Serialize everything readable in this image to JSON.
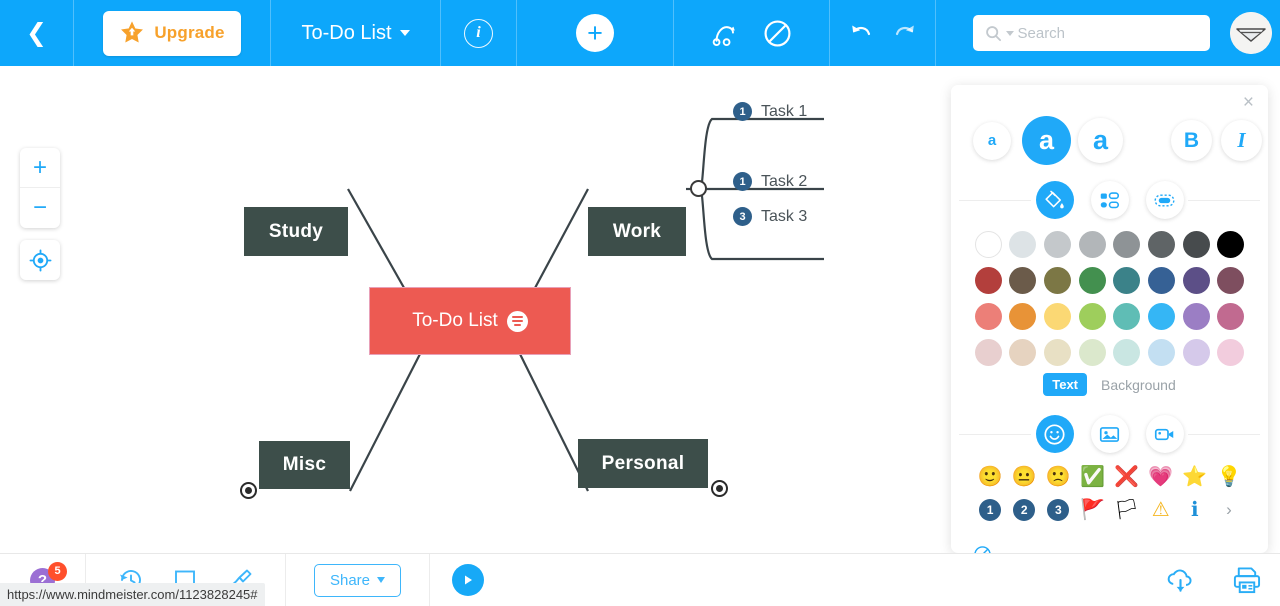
{
  "toolbar": {
    "back_icon": "chevron-left-icon",
    "upgrade_label": "Upgrade",
    "upgrade_icon": "star-icon",
    "map_title": "To-Do List",
    "title_caret_icon": "chevron-down-icon",
    "info_icon": "info-icon",
    "info_glyph": "i",
    "add_icon": "plus-icon",
    "add_glyph": "+",
    "connection_icon": "connection-icon",
    "noentry_icon": "no-entry-icon",
    "undo_icon": "undo-icon",
    "redo_icon": "redo-icon",
    "search_placeholder": "Search",
    "search_value": "",
    "search_icon": "search-icon",
    "avatar_icon": "user-avatar",
    "bg_color": "#0DA7FB"
  },
  "zoom_controls": {
    "zoom_in_label": "+",
    "zoom_out_label": "−",
    "center_icon": "crosshair-icon"
  },
  "map": {
    "root": {
      "label": "To-Do List",
      "color": "#ED5A52",
      "note_icon": "note-icon"
    },
    "branches": [
      {
        "label": "Study",
        "color": "#3D4E4A"
      },
      {
        "label": "Work",
        "color": "#3D4E4A"
      },
      {
        "label": "Misc",
        "color": "#3D4E4A"
      },
      {
        "label": "Personal",
        "color": "#3D4E4A"
      }
    ],
    "tasks": [
      {
        "badge": "1",
        "label": "Task 1"
      },
      {
        "badge": "1",
        "label": "Task 2"
      },
      {
        "badge": "3",
        "label": "Task 3"
      }
    ],
    "badge_color": "#2E5F8A",
    "line_color": "#3A4449"
  },
  "style_panel": {
    "close_icon": "close-icon",
    "close_glyph": "×",
    "font_buttons": [
      {
        "label": "a",
        "name": "font-size-small",
        "active": false
      },
      {
        "label": "a",
        "name": "font-size-medium",
        "active": true
      },
      {
        "label": "a",
        "name": "font-size-large",
        "active": false
      },
      {
        "label": "B",
        "name": "bold",
        "active": false
      },
      {
        "label": "I",
        "name": "italic",
        "active": false
      }
    ],
    "mode_buttons": [
      {
        "name": "paint-bucket-icon",
        "active": true
      },
      {
        "name": "node-style-icon",
        "active": false
      },
      {
        "name": "border-style-icon",
        "active": false
      }
    ],
    "colors": [
      "#ffffff",
      "#dde3e6",
      "#c4c8cb",
      "#b2b6b9",
      "#8e9396",
      "#5f6466",
      "#474b4d",
      "#000000",
      "#b33f3c",
      "#6b5b4a",
      "#7c7745",
      "#43904f",
      "#3b8289",
      "#366195",
      "#5c4f87",
      "#7e4e5f",
      "#ec7f78",
      "#e89337",
      "#fbd874",
      "#9ece5c",
      "#5fbdb5",
      "#35b6f5",
      "#9b7ec4",
      "#c16a90",
      "#e8cfcf",
      "#e6d3c0",
      "#e8e0c4",
      "#dbe8cc",
      "#c9e6e2",
      "#c3dff2",
      "#d5c9ea",
      "#f2ccdd"
    ],
    "text_label": "Text",
    "background_label": "Background",
    "icon_tabs": [
      {
        "name": "smiley-icon",
        "active": true
      },
      {
        "name": "image-icon",
        "active": false
      },
      {
        "name": "video-icon",
        "active": false
      }
    ],
    "emojis": [
      {
        "name": "smile-emoji",
        "glyph": "🙂"
      },
      {
        "name": "neutral-emoji",
        "glyph": "😐"
      },
      {
        "name": "frown-emoji",
        "glyph": "🙁"
      },
      {
        "name": "check-icon",
        "glyph": "✅"
      },
      {
        "name": "cross-icon",
        "glyph": "❌"
      },
      {
        "name": "heart-icon",
        "glyph": "💗"
      },
      {
        "name": "star-icon",
        "glyph": "⭐"
      },
      {
        "name": "lightbulb-icon",
        "glyph": "💡"
      }
    ],
    "emojis_row2": [
      {
        "name": "number-1-badge",
        "glyph": "1"
      },
      {
        "name": "number-2-badge",
        "glyph": "2"
      },
      {
        "name": "number-3-badge",
        "glyph": "3"
      },
      {
        "name": "red-flag-icon",
        "glyph": "🚩"
      },
      {
        "name": "green-flag-icon",
        "glyph": "🏳"
      },
      {
        "name": "warning-icon",
        "glyph": "⚠"
      },
      {
        "name": "info-badge-icon",
        "glyph": "ℹ"
      },
      {
        "name": "more-chevron-icon",
        "glyph": "›"
      }
    ],
    "clear_icon": "clear-icon"
  },
  "bottombar": {
    "help_glyph": "?",
    "help_icon": "help-icon",
    "help_badge": "5",
    "history_icon": "history-icon",
    "frame_icon": "frame-icon",
    "pencil_icon": "pencil-icon",
    "share_label": "Share",
    "share_caret_icon": "chevron-down-icon",
    "play_icon": "play-icon",
    "download_icon": "cloud-download-icon",
    "print_icon": "print-icon"
  },
  "status": {
    "url": "https://www.mindmeister.com/1123828245#"
  }
}
